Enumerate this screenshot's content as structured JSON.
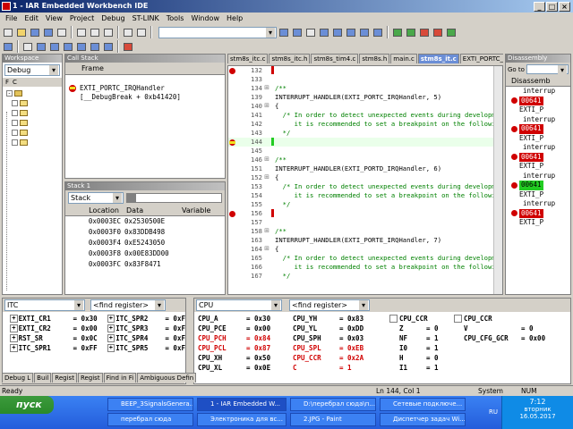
{
  "window": {
    "title": "1 - IAR Embedded Workbench IDE",
    "min": "_",
    "max": "□",
    "close": "×"
  },
  "menu": [
    "File",
    "Edit",
    "View",
    "Project",
    "Debug",
    "ST-LINK",
    "Tools",
    "Window",
    "Help"
  ],
  "workspace": {
    "header": "Workspace",
    "mode": "Debug",
    "cols": [
      "F",
      "C"
    ]
  },
  "callstack": {
    "header": "Call Stack",
    "col": "Frame",
    "frames": [
      "EXTI_PORTC_IRQHandler",
      "[__DebugBreak + 0xb41420]"
    ]
  },
  "stack": {
    "header": "Stack 1",
    "select": "Stack",
    "cols": [
      "Location",
      "Data",
      "Variable"
    ],
    "rows": [
      [
        "0x0003EC",
        "0x2530500E"
      ],
      [
        "0x0003F0",
        "0x83DDB498"
      ],
      [
        "0x0003F4",
        "0xE5243050"
      ],
      [
        "0x0003F8",
        "0x00E83DD00"
      ],
      [
        "0x0003FC",
        "0x83F8471"
      ]
    ]
  },
  "tabs": [
    "stm8s_itc.c",
    "stm8s_itc.h",
    "stm8s_tim4.c",
    "stm8s.h",
    "main.c",
    "stm8s_it.c",
    "EXTI_PORTC_IRQHz"
  ],
  "code": [
    {
      "n": "132",
      "t": "",
      "bp": true
    },
    {
      "n": "133",
      "t": ""
    },
    {
      "n": "134",
      "t": "/**",
      "c": "cm"
    },
    {
      "n": "139",
      "t": "INTERRUPT_HANDLER(EXTI_PORTC_IRQHandler, 5)"
    },
    {
      "n": "140",
      "t": "{"
    },
    {
      "n": "141",
      "t": "  /* In order to detect unexpected events during developme",
      "c": "cm"
    },
    {
      "n": "142",
      "t": "     it is recommended to set a breakpoint on the followin",
      "c": "cm"
    },
    {
      "n": "143",
      "t": "  */",
      "c": "cm"
    },
    {
      "n": "144",
      "t": "",
      "bp": true,
      "cur": true
    },
    {
      "n": "145",
      "t": ""
    },
    {
      "n": "146",
      "t": "/**",
      "c": "cm"
    },
    {
      "n": "151",
      "t": "INTERRUPT_HANDLER(EXTI_PORTD_IRQHandler, 6)"
    },
    {
      "n": "152",
      "t": "{"
    },
    {
      "n": "153",
      "t": "  /* In order to detect unexpected events during developme",
      "c": "cm"
    },
    {
      "n": "154",
      "t": "     it is recommended to set a breakpoint on the followin",
      "c": "cm"
    },
    {
      "n": "155",
      "t": "  */",
      "c": "cm"
    },
    {
      "n": "156",
      "t": "",
      "bp": true
    },
    {
      "n": "157",
      "t": ""
    },
    {
      "n": "158",
      "t": "/**",
      "c": "cm"
    },
    {
      "n": "163",
      "t": "INTERRUPT_HANDLER(EXTI_PORTE_IRQHandler, 7)"
    },
    {
      "n": "164",
      "t": "{"
    },
    {
      "n": "165",
      "t": "  /* In order to detect unexpected events during developme",
      "c": "cm"
    },
    {
      "n": "166",
      "t": "     it is recommended to set a breakpoint on the followin",
      "c": "cm"
    },
    {
      "n": "167",
      "t": "  */",
      "c": "cm"
    }
  ],
  "disasm": {
    "header": "Disassembly",
    "goto": "Go to",
    "col": "Disassemb",
    "rows": [
      {
        "t": "interrup"
      },
      {
        "t": "00641",
        "r": true
      },
      {
        "t": "EXTI_P"
      },
      {
        "t": "interrup"
      },
      {
        "t": "00641",
        "r": true
      },
      {
        "t": "EXTI_P"
      },
      {
        "t": "interrup"
      },
      {
        "t": "00641",
        "r": true
      },
      {
        "t": "EXTI_P"
      },
      {
        "t": "interrup"
      },
      {
        "t": "00641",
        "g": true
      },
      {
        "t": "EXTI_P"
      },
      {
        "t": "interrup"
      },
      {
        "t": "00641",
        "r": true
      },
      {
        "t": "EXTI_P"
      }
    ]
  },
  "reg1": {
    "select": "ITC",
    "find": "<find register>",
    "rows": [
      [
        "EXTI_CR1",
        "= 0x30",
        "ITC_SPR2",
        "= 0xF"
      ],
      [
        "EXTI_CR2",
        "= 0x00",
        "ITC_SPR3",
        "= 0xF"
      ],
      [
        "RST_SR",
        "= 0x0C",
        "ITC_SPR4",
        "= 0xF"
      ],
      [
        "ITC_SPR1",
        "= 0xFF",
        "ITC_SPR5",
        "= 0xF"
      ]
    ]
  },
  "reg2": {
    "select": "CPU",
    "find": "<find register>",
    "col1": [
      [
        "CPU_A",
        "= 0x30",
        false
      ],
      [
        "CPU_PCE",
        "= 0x00",
        false
      ],
      [
        "CPU_PCH",
        "= 0x84",
        true
      ],
      [
        "CPU_PCL",
        "= 0x87",
        true
      ],
      [
        "CPU_XH",
        "= 0x50",
        false
      ],
      [
        "CPU_XL",
        "= 0x0E",
        false
      ]
    ],
    "col2": [
      [
        "CPU_YH",
        "= 0x83",
        false
      ],
      [
        "CPU_YL",
        "= 0xDD",
        false
      ],
      [
        "CPU_SPH",
        "= 0x03",
        false
      ],
      [
        "CPU_SPL",
        "= 0xEB",
        true
      ],
      [
        "CPU_CCR",
        "= 0x2A",
        true
      ],
      [
        "C",
        "= 1",
        true
      ]
    ],
    "col3": [
      [
        "CPU_CCR",
        ""
      ],
      [
        "Z",
        "= 0"
      ],
      [
        "NF",
        "= 1"
      ],
      [
        "I0",
        "= 1"
      ],
      [
        "H",
        "= 0"
      ],
      [
        "I1",
        "= 1"
      ]
    ],
    "col4": [
      [
        "CPU_CCR",
        ""
      ],
      [
        "V",
        "= 0"
      ],
      [
        "CPU_CFG_GCR",
        "= 0x00"
      ]
    ]
  },
  "bottomtabs": [
    "Debug L",
    "Buil",
    "Regist",
    "Regist",
    "Find in Fi",
    "Ambiguous Defin"
  ],
  "status": {
    "left": "Ready",
    "pos": "Ln 144, Col 1",
    "sys": "System",
    "num": "NUM"
  },
  "taskbar": {
    "start": "пуск",
    "lang": "RU",
    "time": "7:12",
    "day": "вторник",
    "date": "16.05.2017",
    "row1": [
      "BEEP_3SignalsGenera...",
      "1 - IAR Embedded W...",
      "D:\\перебрал сюда\\п...",
      "Сетевые подключе..."
    ],
    "row2": [
      "перебрал сюда",
      "Электроника для вс...",
      "2.JPG - Paint",
      "Диспетчер задач Wi..."
    ]
  }
}
